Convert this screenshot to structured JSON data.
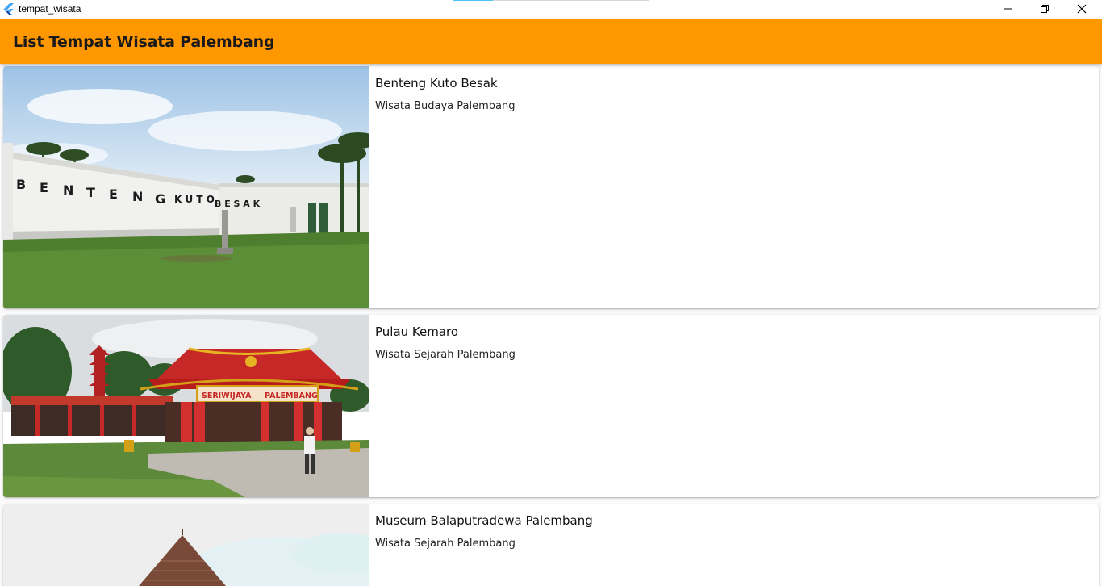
{
  "window": {
    "title": "tempat_wisata",
    "icon": "flutter-logo"
  },
  "appbar": {
    "title": "List Tempat Wisata Palembang",
    "color": "#ff9800"
  },
  "places": [
    {
      "name": "Benteng Kuto Besak",
      "category": "Wisata Budaya Palembang",
      "image_sign": "BENTENG KUTO BESAK"
    },
    {
      "name": "Pulau Kemaro",
      "category": "Wisata Sejarah Palembang",
      "image_sign": "SERIWIJAYA PALEMBANG"
    },
    {
      "name": "Museum Balaputradewa Palembang",
      "category": "Wisata Sejarah Palembang"
    }
  ]
}
